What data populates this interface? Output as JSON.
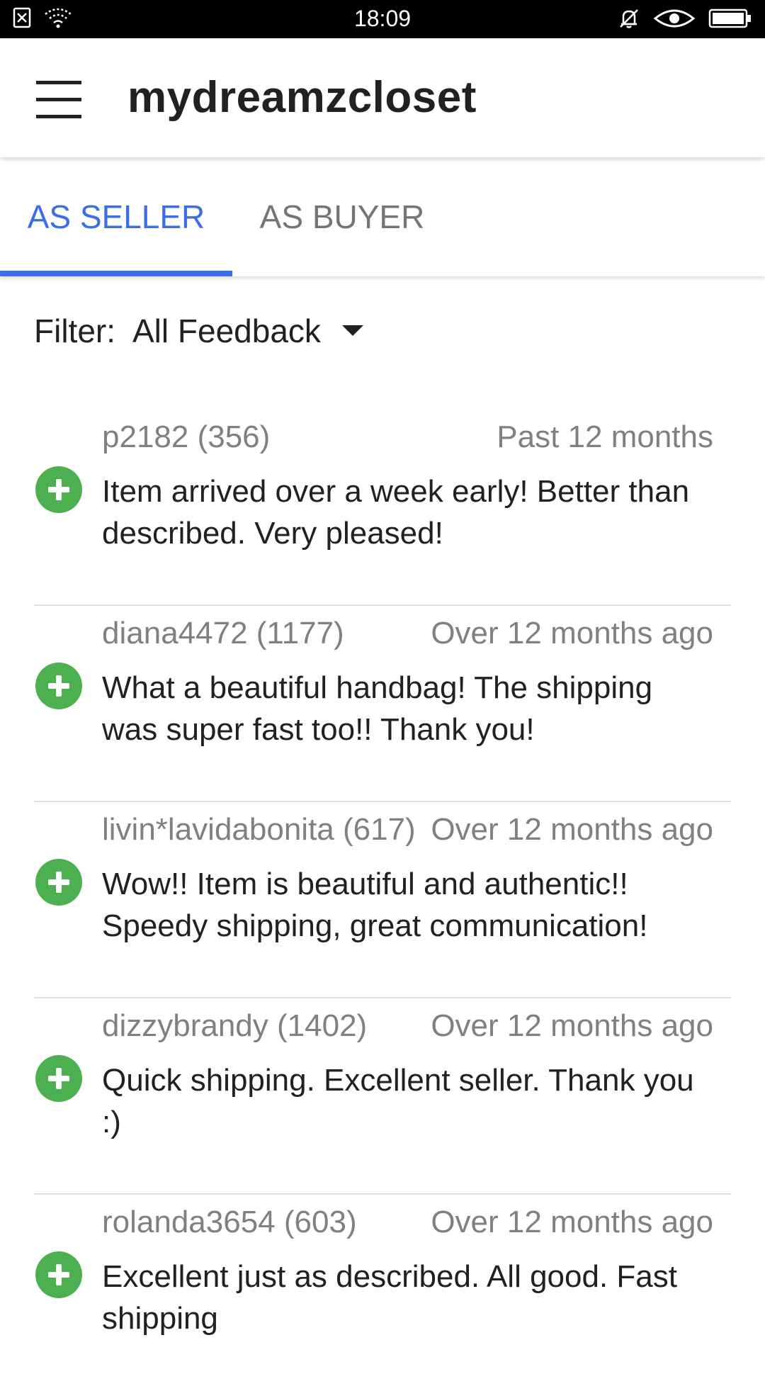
{
  "status_bar": {
    "time": "18:09"
  },
  "app_bar": {
    "title": "mydreamzcloset"
  },
  "tabs": [
    {
      "label": "AS SELLER",
      "active": true
    },
    {
      "label": "AS BUYER",
      "active": false
    }
  ],
  "filter": {
    "label": "Filter:",
    "value": "All Feedback"
  },
  "colors": {
    "accent": "#3b6ee8",
    "positive": "#4caf50",
    "secondary_text": "#808080"
  },
  "feedback": [
    {
      "user": "p2182 (356)",
      "time": "Past 12 months",
      "text": "Item arrived over a week early!  Better than described. Very pleased!",
      "rating_icon": "plus-icon"
    },
    {
      "user": "diana4472 (1177)",
      "time": "Over 12 months ago",
      "text": "What a beautiful handbag! The shipping was super fast too!! Thank you!",
      "rating_icon": "plus-icon"
    },
    {
      "user": "livin*lavidabonita (617)",
      "time": "Over 12 months ago",
      "text": "Wow!! Item is beautiful and authentic!! Speedy shipping, great communication!",
      "rating_icon": "plus-icon"
    },
    {
      "user": "dizzybrandy (1402)",
      "time": "Over 12 months ago",
      "text": "Quick shipping. Excellent seller. Thank you :)",
      "rating_icon": "plus-icon"
    },
    {
      "user": "rolanda3654 (603)",
      "time": "Over 12 months ago",
      "text": "Excellent just as described. All good. Fast shipping",
      "rating_icon": "plus-icon"
    }
  ]
}
